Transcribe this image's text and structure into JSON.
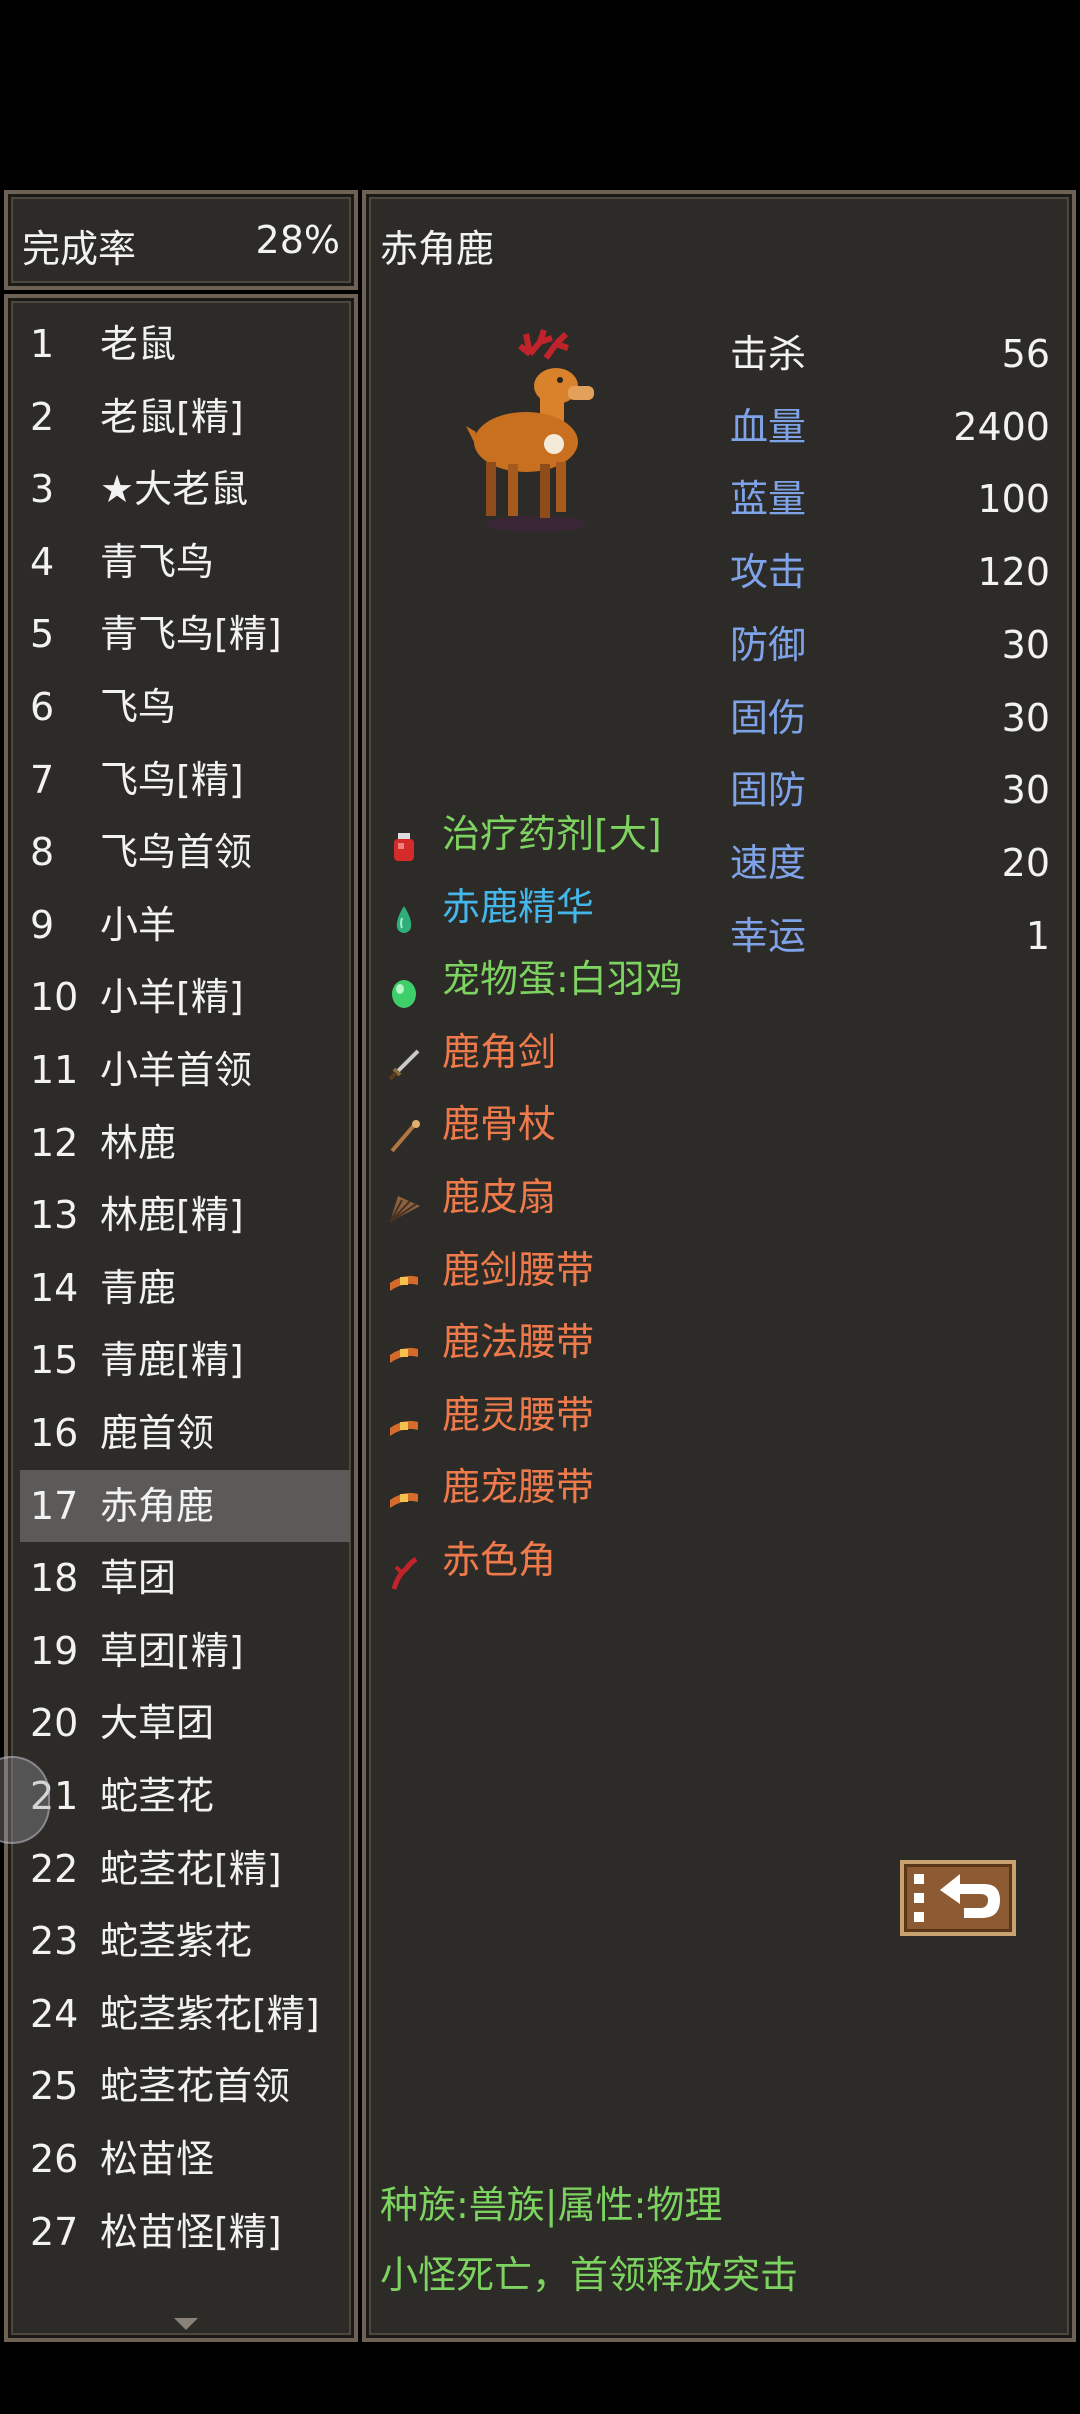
{
  "completion": {
    "label": "完成率",
    "value": "28%"
  },
  "monster_list": [
    {
      "num": "1",
      "name": "老鼠"
    },
    {
      "num": "2",
      "name": "老鼠[精]"
    },
    {
      "num": "3",
      "name": "★大老鼠"
    },
    {
      "num": "4",
      "name": "青飞鸟"
    },
    {
      "num": "5",
      "name": "青飞鸟[精]"
    },
    {
      "num": "6",
      "name": "飞鸟"
    },
    {
      "num": "7",
      "name": "飞鸟[精]"
    },
    {
      "num": "8",
      "name": "飞鸟首领"
    },
    {
      "num": "9",
      "name": "小羊"
    },
    {
      "num": "10",
      "name": "小羊[精]"
    },
    {
      "num": "11",
      "name": "小羊首领"
    },
    {
      "num": "12",
      "name": "林鹿"
    },
    {
      "num": "13",
      "name": "林鹿[精]"
    },
    {
      "num": "14",
      "name": "青鹿"
    },
    {
      "num": "15",
      "name": "青鹿[精]"
    },
    {
      "num": "16",
      "name": "鹿首领"
    },
    {
      "num": "17",
      "name": "赤角鹿"
    },
    {
      "num": "18",
      "name": "草团"
    },
    {
      "num": "19",
      "name": "草团[精]"
    },
    {
      "num": "20",
      "name": "大草团"
    },
    {
      "num": "21",
      "name": "蛇茎花"
    },
    {
      "num": "22",
      "name": "蛇茎花[精]"
    },
    {
      "num": "23",
      "name": "蛇茎紫花"
    },
    {
      "num": "24",
      "name": "蛇茎紫花[精]"
    },
    {
      "num": "25",
      "name": "蛇茎花首领"
    },
    {
      "num": "26",
      "name": "松苗怪"
    },
    {
      "num": "27",
      "name": "松苗怪[精]"
    }
  ],
  "selected_index": 16,
  "detail": {
    "title": "赤角鹿",
    "stats": [
      {
        "label": "击杀",
        "value": "56",
        "color": "white"
      },
      {
        "label": "血量",
        "value": "2400",
        "color": "blue"
      },
      {
        "label": "蓝量",
        "value": "100",
        "color": "blue"
      },
      {
        "label": "攻击",
        "value": "120",
        "color": "blue"
      },
      {
        "label": "防御",
        "value": "30",
        "color": "blue"
      },
      {
        "label": "固伤",
        "value": "30",
        "color": "blue"
      },
      {
        "label": "固防",
        "value": "30",
        "color": "blue"
      },
      {
        "label": "速度",
        "value": "20",
        "color": "blue"
      },
      {
        "label": "幸运",
        "value": "1",
        "color": "blue"
      }
    ],
    "drops": [
      {
        "name": "治疗药剂[大]",
        "color": "green",
        "icon": "potion-icon"
      },
      {
        "name": "赤鹿精华",
        "color": "cyan",
        "icon": "essence-drop-icon"
      },
      {
        "name": "宠物蛋:白羽鸡",
        "color": "green",
        "icon": "pet-egg-icon"
      },
      {
        "name": "鹿角剑",
        "color": "orange",
        "icon": "sword-icon"
      },
      {
        "name": "鹿骨杖",
        "color": "orange",
        "icon": "staff-icon"
      },
      {
        "name": "鹿皮扇",
        "color": "orange",
        "icon": "fan-icon"
      },
      {
        "name": "鹿剑腰带",
        "color": "orange",
        "icon": "belt-icon"
      },
      {
        "name": "鹿法腰带",
        "color": "orange",
        "icon": "belt-icon"
      },
      {
        "name": "鹿灵腰带",
        "color": "orange",
        "icon": "belt-icon"
      },
      {
        "name": "鹿宠腰带",
        "color": "orange",
        "icon": "belt-icon"
      },
      {
        "name": "赤色角",
        "color": "orange",
        "icon": "red-horn-icon"
      }
    ],
    "race_info": "种族:兽族|属性:物理",
    "death_info": "小怪死亡，首领释放突击"
  },
  "colors": {
    "panel_bg": "#2d2b28",
    "border": "#6e6254",
    "stat_label_blue": "#7fa3e8",
    "drop_green": "#7dd35f",
    "drop_cyan": "#45b6ea",
    "drop_orange": "#ee7a4c"
  }
}
